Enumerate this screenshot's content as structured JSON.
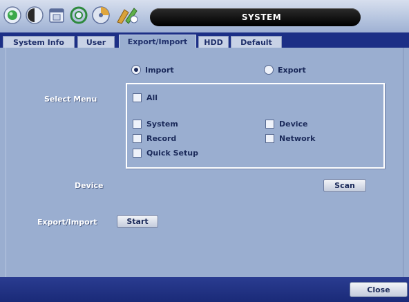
{
  "window": {
    "title": "SYSTEM"
  },
  "toolbar": {
    "icons": [
      {
        "name": "status-icon",
        "color": "#3aa84a"
      },
      {
        "name": "display-icon",
        "color": "#2a2a2a"
      },
      {
        "name": "calendar-icon",
        "color": "#5a6c9a"
      },
      {
        "name": "network-icon",
        "color": "#2e8a3e"
      },
      {
        "name": "disk-icon",
        "color": "#5a6c9a"
      },
      {
        "name": "system-tools-icon",
        "color": "#d8a23a"
      }
    ]
  },
  "tabs": [
    {
      "label": "System Info"
    },
    {
      "label": "User"
    },
    {
      "label": "Export/Import",
      "active": true
    },
    {
      "label": "HDD"
    },
    {
      "label": "Default"
    }
  ],
  "mode": {
    "import_label": "Import",
    "export_label": "Export",
    "selected": "Import"
  },
  "select_menu": {
    "label": "Select Menu",
    "all_label": "All",
    "items": {
      "system": "System",
      "device": "Device",
      "record": "Record",
      "network": "Network",
      "quick_setup": "Quick Setup"
    }
  },
  "device": {
    "label": "Device",
    "scan_label": "Scan"
  },
  "export_import": {
    "label": "Export/Import",
    "start_label": "Start"
  },
  "footer": {
    "close_label": "Close"
  },
  "colors": {
    "background": "#9aaed0",
    "tab_bar": "#1c2f86",
    "title_pill": "#000000"
  }
}
